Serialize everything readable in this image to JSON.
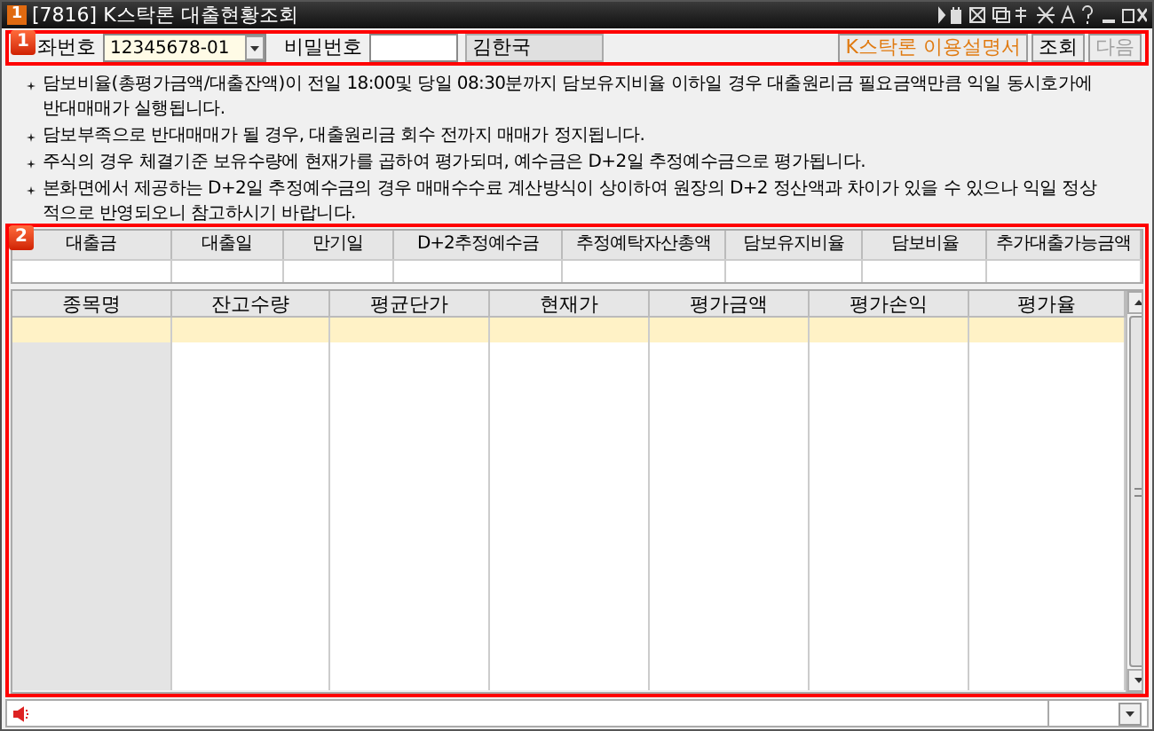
{
  "window": {
    "badge": "1",
    "title": "[7816] K스탁론 대출현황조회"
  },
  "toolbar": {
    "badge": "1",
    "account_label": "좌번호",
    "account_value": "12345678-01",
    "password_label": "비밀번호",
    "name": "김한국",
    "buttons": [
      {
        "label": "K스탁론 이용설명서",
        "kind": "guide",
        "disabled": false
      },
      {
        "label": "조회",
        "kind": "plain",
        "disabled": false
      },
      {
        "label": "다음",
        "kind": "plain",
        "disabled": true
      }
    ]
  },
  "notes": [
    "담보비율(총평가금액/대출잔액)이 전일 18:00및 당일 08:30분까지 담보유지비율 이하일 경우 대출원리금 필요금액만큼 익일 동시호가에 반대매매가 실행됩니다.",
    "담보부족으로 반대매매가 될 경우, 대출원리금 회수 전까지 매매가 정지됩니다.",
    "주식의 경우 체결기준 보유수량에 현재가를 곱하여 평가되며, 예수금은 D+2일 추정예수금으로 평가됩니다.",
    "본화면에서 제공하는 D+2일 추정예수금의 경우 매매수수료 계산방식이 상이하여 원장의 D+2 정산액과 차이가 있을 수 있으나 익일 정상적으로 반영되오니 참고하시기 바랍니다."
  ],
  "summary": {
    "badge": "2",
    "columns": [
      "대출금",
      "대출일",
      "만기일",
      "D+2추정예수금",
      "추정예탁자산총액",
      "담보유지비율",
      "담보비율",
      "추가대출가능금액"
    ]
  },
  "grid": {
    "columns": [
      "종목명",
      "잔고수량",
      "평균단가",
      "현재가",
      "평가금액",
      "평가손익",
      "평가율"
    ],
    "rows": [
      {
        "selected": true
      },
      {
        "selected": false
      },
      {
        "selected": false
      },
      {
        "selected": false
      },
      {
        "selected": false
      },
      {
        "selected": false
      },
      {
        "selected": false
      },
      {
        "selected": false
      },
      {
        "selected": false
      },
      {
        "selected": false
      },
      {
        "selected": false
      },
      {
        "selected": false
      },
      {
        "selected": false
      },
      {
        "selected": false
      },
      {
        "selected": false
      }
    ]
  }
}
